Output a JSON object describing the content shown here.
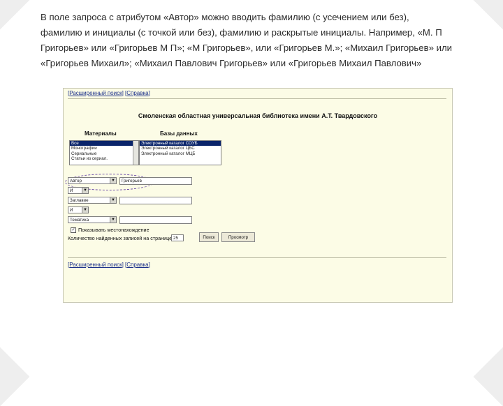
{
  "slide": {
    "paragraph_lines": [
      "В поле запроса с атрибутом «Автор» можно вводить фамилию (с усечением или без),",
      "фамилию и инициалы (с точкой или без), фамилию и раскрытые инициалы. Например, «М. П",
      "Григорьев» или «Григорьев М П»; «М Григорьев», или «Григорьев М.»; «Михаил Григорьев» или",
      "«Григорьев Михаил»; «Михаил Павлович Григорьев» или «Григорьев Михаил Павлович»"
    ]
  },
  "search_form": {
    "top_nav": {
      "extended_search": "Расширенный поиск",
      "help": "Справка"
    },
    "bottom_nav": {
      "extended_search": "Расширенный поиск",
      "help": "Справка"
    },
    "library_title": "Смоленская областная универсальная библиотека имени А.Т. Твардовского",
    "materials": {
      "header": "Материалы",
      "items": [
        "Все",
        "Монографии",
        "Сериальные",
        "Статьи из сериал."
      ],
      "selected_index": 0
    },
    "databases": {
      "header": "Базы данных",
      "items": [
        "Электронный каталог СОУБ",
        "Электронный каталог ЦБС",
        "Электронный каталог МЦБ"
      ],
      "selected_index": 0
    },
    "query_rows": [
      {
        "attribute": "Автор",
        "value": "Григорьев",
        "logic": "И"
      },
      {
        "attribute": "Заглавие",
        "value": "",
        "logic": "И"
      },
      {
        "attribute": "Тематика",
        "value": ""
      }
    ],
    "show_location_label": "Показывать местонахождение",
    "show_location_checked": true,
    "count_label": "Количество найденных записей на странице",
    "count_value": "25",
    "search_button": "Поиск",
    "browse_button": "Просмотр"
  }
}
